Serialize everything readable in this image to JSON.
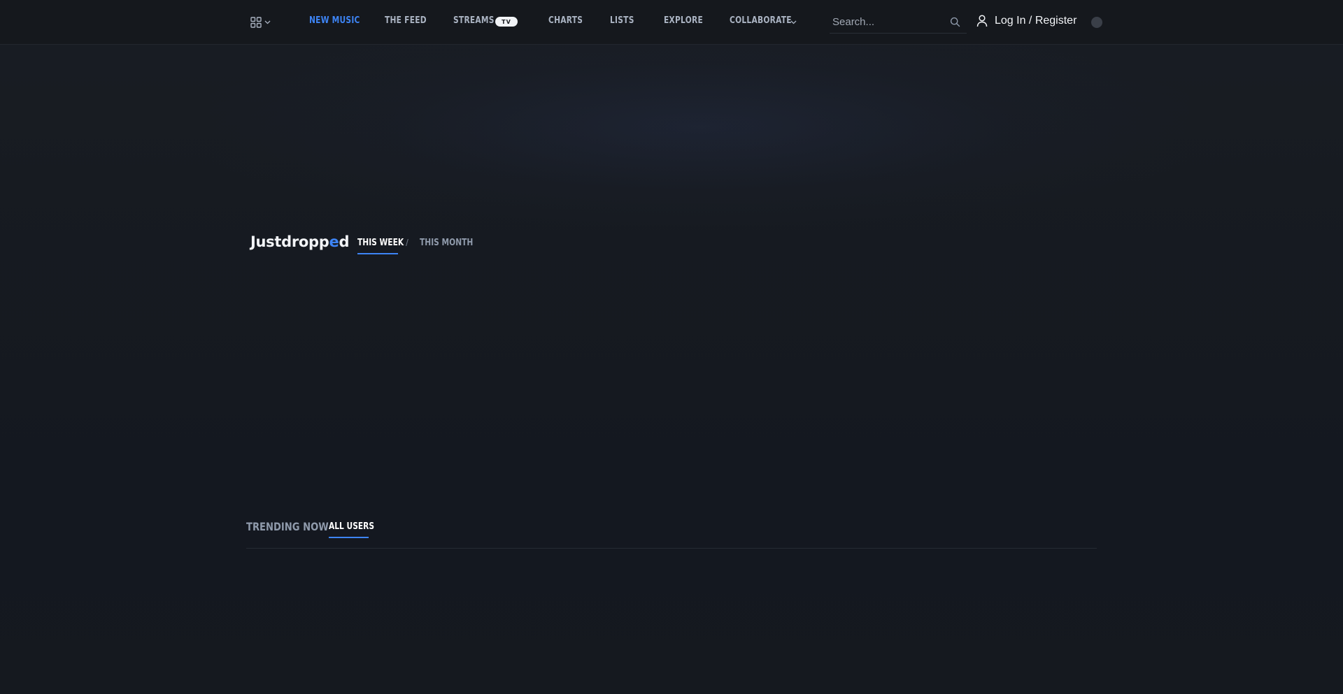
{
  "nav": {
    "links": [
      {
        "label": "New Music",
        "active": true
      },
      {
        "label": "The Feed",
        "active": false
      },
      {
        "label": "Streams",
        "active": false,
        "badge": "TV"
      },
      {
        "label": "Charts",
        "active": false
      },
      {
        "label": "Lists",
        "active": false
      },
      {
        "label": "Explore",
        "active": false
      },
      {
        "label": "Collaborate",
        "active": false
      }
    ],
    "search_placeholder": "Search...",
    "login_label": "Log In / Register"
  },
  "brand": {
    "logo_pre": "Justdropp",
    "logo_accent": "e",
    "logo_post": "d"
  },
  "period_tabs": {
    "this_week": "This Week",
    "separator": "/",
    "this_month": "This Month"
  },
  "trending": {
    "title": "Trending Now",
    "tab": "All Users"
  },
  "colors": {
    "accent": "#3d84f5",
    "background": "#14171c"
  }
}
